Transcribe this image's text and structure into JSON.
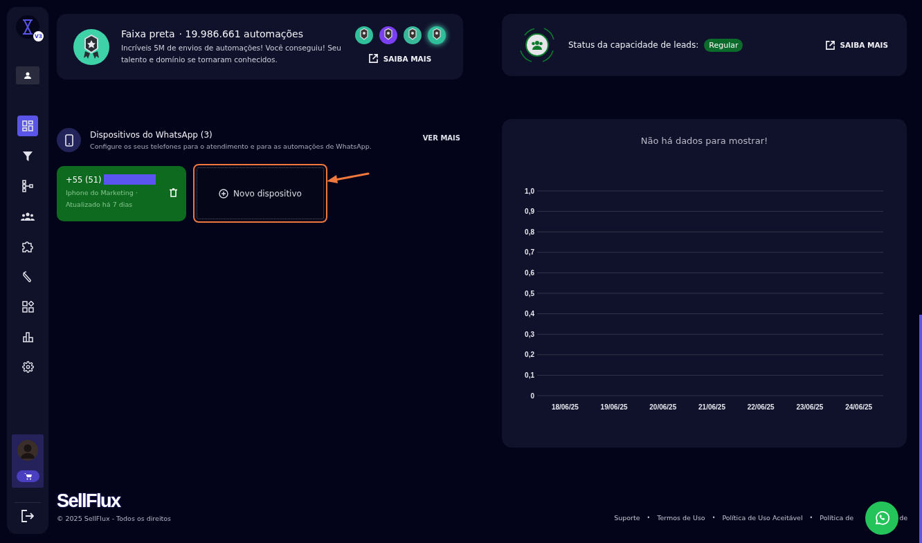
{
  "sidebar": {
    "logo_badge": "V3",
    "items": [
      {
        "kind": "dashboard",
        "selected": true
      },
      {
        "kind": "funnel",
        "selected": false
      },
      {
        "kind": "flow",
        "selected": false
      },
      {
        "kind": "team",
        "selected": false
      },
      {
        "kind": "puzzle",
        "selected": false
      },
      {
        "kind": "wrench",
        "selected": false
      },
      {
        "kind": "apps",
        "selected": false
      },
      {
        "kind": "chart",
        "selected": false
      },
      {
        "kind": "gear",
        "selected": false
      }
    ]
  },
  "achievement": {
    "title": "Faixa preta",
    "count": "· 19.986.661 automações",
    "message": "Incríveis 5M de envios de automações! Você conseguiu! Seu talento e domínio se tornaram conhecidos.",
    "medals": [
      {
        "color": "#2fbf9a",
        "selected": false
      },
      {
        "color": "#7b3ff2",
        "selected": false
      },
      {
        "color": "#3ab99a",
        "selected": false
      },
      {
        "color": "#2fbf9a",
        "selected": true
      }
    ],
    "link": "SAIBA MAIS"
  },
  "leads": {
    "label": "Status da capacidade de leads:",
    "status": "Regular",
    "link": "SAIBA MAIS"
  },
  "devices": {
    "title": "Dispositivos do WhatsApp (3)",
    "subtitle": "Configure os seus telefones para o atendimento e para as automações de WhatsApp.",
    "more": "VER MAIS",
    "items": [
      {
        "phone": "+55 (51)",
        "name": "Iphone do Marketing ·",
        "updated": "Atualizado há 7 dias"
      }
    ],
    "new_device": "Novo dispositivo"
  },
  "chart": {
    "chart_data": {
      "type": "line",
      "grid": true,
      "title": "Não há dados para mostrar!",
      "categories": [
        "18/06/25",
        "19/06/25",
        "20/06/25",
        "21/06/25",
        "22/06/25",
        "23/06/25",
        "24/06/25"
      ],
      "ylim": [
        0,
        1
      ],
      "yticks": [
        {
          "value": 0,
          "label": "0"
        },
        {
          "value": 0.1,
          "label": "0,1"
        },
        {
          "value": 0.2,
          "label": "0,2"
        },
        {
          "value": 0.3,
          "label": "0,3"
        },
        {
          "value": 0.4,
          "label": "0,4"
        },
        {
          "value": 0.5,
          "label": "0,5"
        },
        {
          "value": 0.6,
          "label": "0,6"
        },
        {
          "value": 0.7,
          "label": "0,7"
        },
        {
          "value": 0.8,
          "label": "0,8"
        },
        {
          "value": 0.9,
          "label": "0,9"
        },
        {
          "value": 1,
          "label": "1,0"
        }
      ]
    }
  },
  "footer": {
    "brand": "SellFlux",
    "copyright": "© 2025 SellFlux - Todos os direitos",
    "links": [
      "Suporte",
      "Termos de Uso",
      "Política de Uso Aceitável",
      "Política de"
    ],
    "separators": [
      "•",
      "•",
      "•"
    ],
    "cut_fragment": "de"
  }
}
